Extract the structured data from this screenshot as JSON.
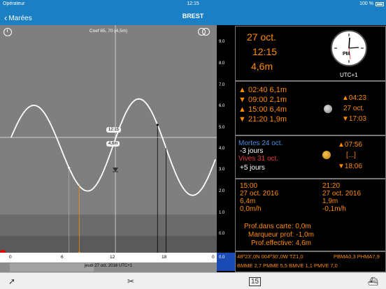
{
  "status": {
    "carrier": "Opérateur",
    "time": "12:15",
    "battery": "100 %"
  },
  "nav": {
    "back_label": "Marées",
    "title": "BREST"
  },
  "chart": {
    "coef": "Coef 65, 70  (4,5m)",
    "y_ticks": [
      "9.0",
      "8.0",
      "7.0",
      "6.0",
      "5.0",
      "4.0",
      "3.0",
      "2.0",
      "1.0",
      "0.0"
    ],
    "x_ticks": [
      "0",
      "6",
      "12",
      "18",
      "0"
    ],
    "cursor_time": "12:15",
    "cursor_height": "4,6m",
    "date_label": "jeudi 27 oct. 2016 UTC+1",
    "depth_value": "0.0"
  },
  "chart_data": {
    "type": "line",
    "xlabel": "",
    "ylabel": "",
    "xlim": [
      0,
      24
    ],
    "ylim": [
      0,
      9.5
    ],
    "tides": [
      {
        "time": 2.67,
        "height": 6.1,
        "kind": "high"
      },
      {
        "time": 9.0,
        "height": 2.1,
        "kind": "low"
      },
      {
        "time": 15.0,
        "height": 6.4,
        "kind": "high"
      },
      {
        "time": 21.33,
        "height": 1.9,
        "kind": "low"
      }
    ],
    "cursor": {
      "time": 12.25,
      "height": 4.6
    }
  },
  "summary": {
    "date": "27 oct.",
    "time": "12:15",
    "height": "4,6m",
    "tz": "UTC+1",
    "clock_label": "PM"
  },
  "tides": [
    {
      "dir": "▲",
      "text": "02:40 6,1m"
    },
    {
      "dir": "▼",
      "text": "09:00 2,1m"
    },
    {
      "dir": "▲",
      "text": "15:00 6,4m"
    },
    {
      "dir": "▼",
      "text": "21:20 1,9m"
    }
  ],
  "moon": {
    "rise": "▲04:23",
    "date": "27 oct.",
    "set": "▼17:03"
  },
  "coeff_info": {
    "mortes": "Mortes 24 oct.",
    "mortes_days": "-3 jours",
    "vives": "Vives 31 oct.",
    "vives_days": "+5 jours"
  },
  "sun": {
    "rise": "▲07:56",
    "mid": "[...]",
    "set": "▼18:06"
  },
  "times": {
    "left": {
      "time": "15:00",
      "date": "27 oct. 2016",
      "height": "6,4m",
      "rate": "0,0m/h"
    },
    "right": {
      "time": "21:20",
      "date": "27 oct. 2016",
      "height": "1,9m",
      "rate": "-0,1m/h"
    }
  },
  "depth": {
    "carte": "Prof.dans carte: 0,0m",
    "marqueur": "Marqueur prof: -1,0m",
    "effective": "Prof.effective: 4,6m"
  },
  "footer": {
    "line1": "48º23',0N 004º30',0W TZ1,0",
    "line1b": "PBMA0,3 PHMA7,9",
    "line2": "BMME 2,7 PMME 5,5 BMVE 1,1 PMVE 7,0"
  },
  "colors": {
    "accent": "#1a7fc3",
    "orange": "#ff8c00",
    "blue": "#4a90e2",
    "red": "#e53935"
  }
}
